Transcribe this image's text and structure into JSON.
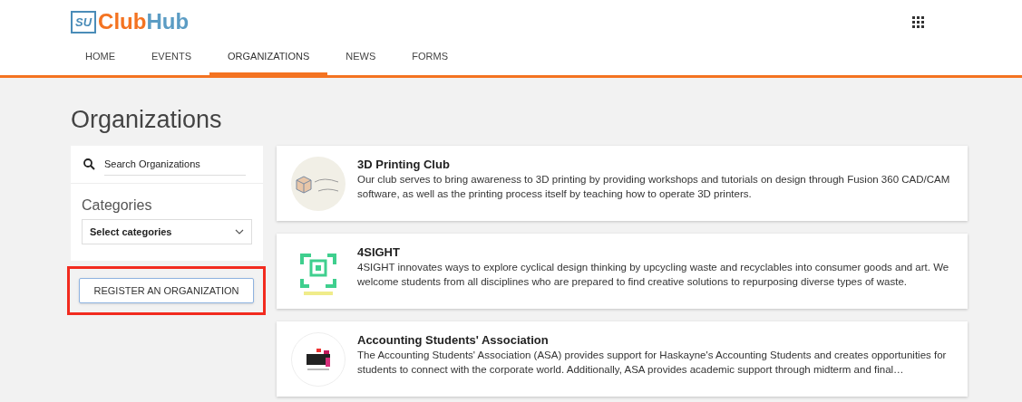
{
  "logo": {
    "badge": "SU",
    "first": "Club",
    "second": "Hub"
  },
  "nav": [
    {
      "label": "HOME",
      "selected": false
    },
    {
      "label": "EVENTS",
      "selected": false
    },
    {
      "label": "ORGANIZATIONS",
      "selected": true
    },
    {
      "label": "NEWS",
      "selected": false
    },
    {
      "label": "FORMS",
      "selected": false
    }
  ],
  "page_title": "Organizations",
  "sidebar": {
    "search": {
      "placeholder": "Search Organizations"
    },
    "categories_label": "Categories",
    "categories_select": "Select categories",
    "register_button": "REGISTER AN ORGANIZATION",
    "register_highlighted": true
  },
  "organizations": [
    {
      "kind": "printing",
      "name": "3D Printing Club",
      "description": "Our club serves to bring awareness to 3D printing by providing workshops and tutorials on design through Fusion 360 CAD/CAM software, as well as the printing process itself by teaching how to operate 3D printers."
    },
    {
      "kind": "foursight",
      "name": "4SIGHT",
      "description": "4SIGHT innovates ways to explore cyclical design thinking by upcycling waste and recyclables into consumer goods and art. We welcome students from all disciplines who are prepared to find creative solutions to repurposing diverse types of waste."
    },
    {
      "kind": "asa",
      "name": "Accounting Students' Association",
      "description": "The Accounting Students' Association (ASA) provides support for Haskayne's Accounting Students and creates opportunities for students to connect with the corporate world. Additionally, ASA provides academic support through midterm and final…"
    }
  ]
}
